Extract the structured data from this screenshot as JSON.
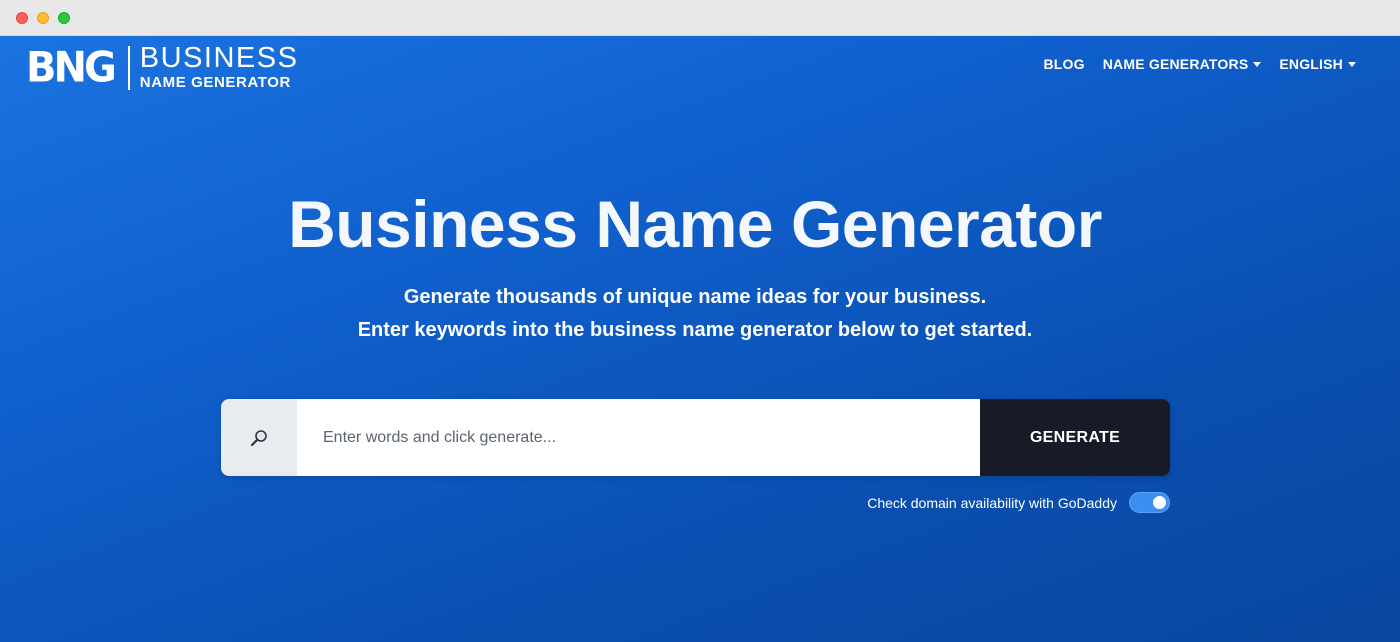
{
  "logo": {
    "mark": "BNG",
    "line1": "BUSINESS",
    "line2": "NAME GENERATOR"
  },
  "nav": {
    "blog": "BLOG",
    "name_generators": "NAME GENERATORS",
    "language": "ENGLISH"
  },
  "hero": {
    "title": "Business Name Generator",
    "subtitle_line1": "Generate thousands of unique name ideas for your business.",
    "subtitle_line2": "Enter keywords into the business name generator below to get started."
  },
  "search": {
    "placeholder": "Enter words and click generate...",
    "value": "",
    "button_label": "GENERATE",
    "icon": "magnifier-icon"
  },
  "domain_check": {
    "label": "Check domain availability with GoDaddy",
    "enabled": true
  },
  "colors": {
    "background_top": "#1b73e0",
    "background_bottom": "#08479f",
    "button": "#161b26",
    "toggle_on": "#3a8ff0"
  }
}
